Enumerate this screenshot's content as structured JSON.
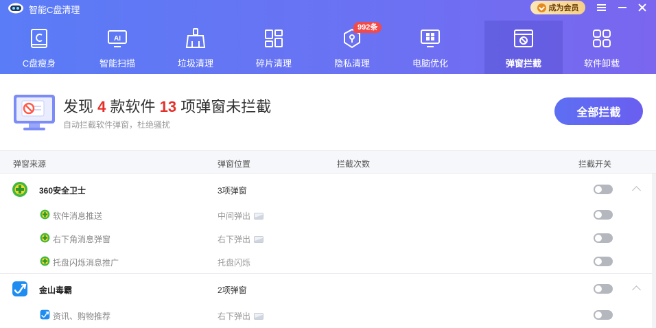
{
  "app": {
    "title": "智能C盘清理",
    "vip_label": "成为会员"
  },
  "nav": [
    {
      "label": "C盘瘦身"
    },
    {
      "label": "智能扫描"
    },
    {
      "label": "垃圾清理"
    },
    {
      "label": "碎片清理"
    },
    {
      "label": "隐私清理",
      "badge": "992条"
    },
    {
      "label": "电脑优化"
    },
    {
      "label": "弹窗拦截"
    },
    {
      "label": "软件卸载"
    }
  ],
  "summary": {
    "prefix": "发现",
    "software_count": "4",
    "middle": "款软件",
    "popup_count": "13",
    "suffix": "项弹窗未拦截",
    "subtitle": "自动拦截软件弹窗，杜绝骚扰",
    "block_all_label": "全部拦截"
  },
  "table": {
    "columns": [
      "弹窗来源",
      "弹窗位置",
      "拦截次数",
      "拦截开关"
    ],
    "groups": [
      {
        "name": "360安全卫士",
        "position": "3项弹窗",
        "items": [
          {
            "name": "软件消息推送",
            "position": "中间弹出"
          },
          {
            "name": "右下角消息弹窗",
            "position": "右下弹出"
          },
          {
            "name": "托盘闪烁消息推广",
            "position": "托盘闪烁"
          }
        ]
      },
      {
        "name": "金山毒霸",
        "position": "2项弹窗",
        "items": [
          {
            "name": "资讯、购物推荐",
            "position": "右下弹出"
          }
        ]
      }
    ]
  },
  "colors": {
    "accent": "#5d6ff3",
    "highlight": "#e5302a",
    "toggle_off": "#b4b7be"
  }
}
